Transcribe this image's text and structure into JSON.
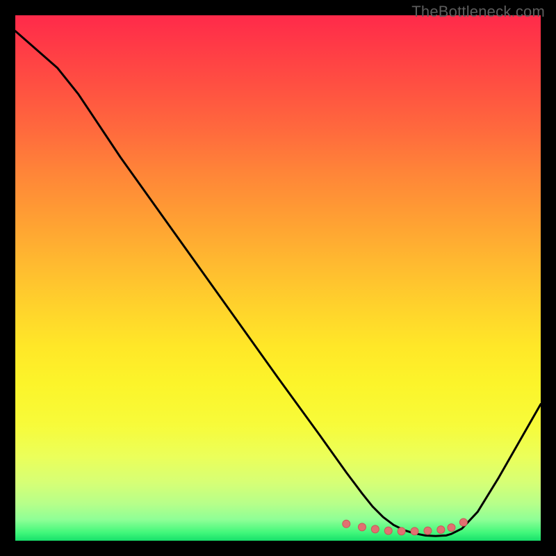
{
  "watermark": "TheBottleneck.com",
  "colors": {
    "line": "#000000",
    "marker_fill": "#e17071",
    "marker_stroke": "#c95858",
    "background_frame": "#000000"
  },
  "chart_data": {
    "type": "line",
    "title": "",
    "xlabel": "",
    "ylabel": "",
    "xlim": [
      0,
      100
    ],
    "ylim": [
      0,
      100
    ],
    "x": [
      0,
      8,
      12,
      20,
      30,
      40,
      50,
      58,
      63,
      66,
      68,
      70,
      72,
      74,
      76,
      78,
      80,
      82,
      83,
      85,
      88,
      92,
      96,
      100
    ],
    "y": [
      97,
      90,
      85,
      73,
      59,
      45,
      31,
      20,
      13,
      9,
      6.5,
      4.5,
      3,
      2,
      1.4,
      1,
      0.9,
      1,
      1.3,
      2.3,
      5.5,
      12,
      19,
      26
    ],
    "markers": {
      "x": [
        63,
        66,
        68.5,
        71,
        73.5,
        76,
        78.5,
        81,
        83,
        85.3
      ],
      "y": [
        3.2,
        2.6,
        2.2,
        1.9,
        1.8,
        1.8,
        1.9,
        2.1,
        2.5,
        3.5
      ]
    }
  }
}
